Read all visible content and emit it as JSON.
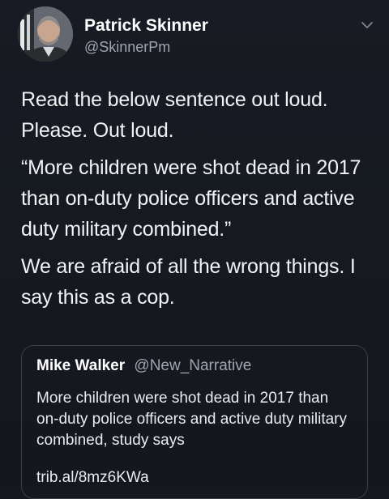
{
  "tweet": {
    "author": {
      "name": "Patrick Skinner",
      "handle": "@SkinnerPm"
    },
    "paragraphs": [
      "Read the below sentence out loud. Please. Out loud.",
      "“More children were shot dead in 2017 than on-duty police officers and active duty military combined.”",
      "We are afraid of all the wrong things. I say this as a cop."
    ],
    "menu_icon": "chevron-down-icon"
  },
  "quoted_tweet": {
    "author": {
      "name": "Mike Walker",
      "handle": "@New_Narrative"
    },
    "text": "More children were shot dead in 2017 than on-duty police officers and active duty military combined, study says",
    "link": "trib.al/8mz6KWa"
  },
  "colors": {
    "background": "#15181f",
    "primary_text": "#f1f2f4",
    "secondary_text": "#9fa6b0",
    "card_border": "#3a3f48"
  }
}
